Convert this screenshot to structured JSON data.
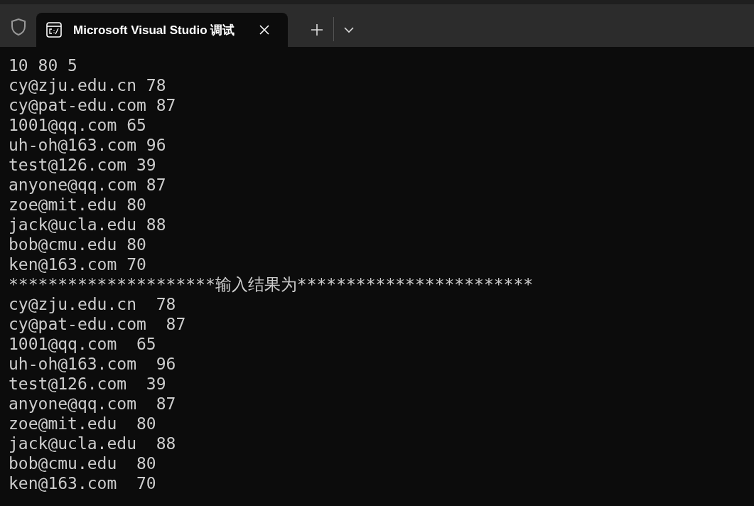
{
  "tab_bar": {
    "tab": {
      "title": "Microsoft Visual Studio 调试",
      "selected": true
    }
  },
  "console": {
    "lines": [
      "10 80 5",
      "cy@zju.edu.cn 78",
      "cy@pat-edu.com 87",
      "1001@qq.com 65",
      "uh-oh@163.com 96",
      "test@126.com 39",
      "anyone@qq.com 87",
      "zoe@mit.edu 80",
      "jack@ucla.edu 88",
      "bob@cmu.edu 80",
      "ken@163.com 70",
      "*********************输入结果为************************",
      "cy@zju.edu.cn  78",
      "cy@pat-edu.com  87",
      "1001@qq.com  65",
      "uh-oh@163.com  96",
      "test@126.com  39",
      "anyone@qq.com  87",
      "zoe@mit.edu  80",
      "jack@ucla.edu  88",
      "bob@cmu.edu  80",
      "ken@163.com  70"
    ]
  }
}
